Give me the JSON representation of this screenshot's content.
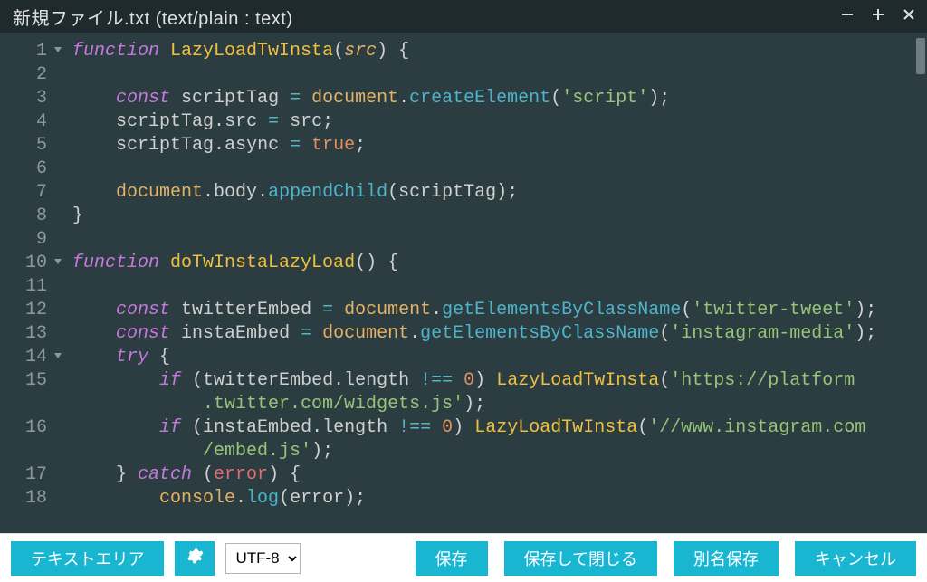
{
  "title": "新規ファイル.txt (text/plain : text)",
  "gutter": {
    "lines": [
      "1",
      "2",
      "3",
      "4",
      "5",
      "6",
      "7",
      "8",
      "9",
      "10",
      "11",
      "12",
      "13",
      "14",
      "15",
      "",
      "16",
      "",
      "17",
      "18"
    ],
    "fold_at": [
      0,
      9,
      13
    ]
  },
  "code": [
    [
      [
        "kw",
        "function"
      ],
      [
        "punc",
        " "
      ],
      [
        "fn",
        "LazyLoadTwInsta"
      ],
      [
        "punc",
        "("
      ],
      [
        "param",
        "src"
      ],
      [
        "punc",
        ") {"
      ]
    ],
    [],
    [
      [
        "punc",
        "    "
      ],
      [
        "kw",
        "const"
      ],
      [
        "punc",
        " "
      ],
      [
        "var",
        "scriptTag"
      ],
      [
        "punc",
        " "
      ],
      [
        "op",
        "="
      ],
      [
        "punc",
        " "
      ],
      [
        "obj",
        "document"
      ],
      [
        "punc",
        "."
      ],
      [
        "method",
        "createElement"
      ],
      [
        "punc",
        "("
      ],
      [
        "str",
        "'script'"
      ],
      [
        "punc",
        ");"
      ]
    ],
    [
      [
        "punc",
        "    "
      ],
      [
        "var",
        "scriptTag"
      ],
      [
        "punc",
        "."
      ],
      [
        "prop",
        "src"
      ],
      [
        "punc",
        " "
      ],
      [
        "op",
        "="
      ],
      [
        "punc",
        " "
      ],
      [
        "var",
        "src"
      ],
      [
        "punc",
        ";"
      ]
    ],
    [
      [
        "punc",
        "    "
      ],
      [
        "var",
        "scriptTag"
      ],
      [
        "punc",
        "."
      ],
      [
        "prop",
        "async"
      ],
      [
        "punc",
        " "
      ],
      [
        "op",
        "="
      ],
      [
        "punc",
        " "
      ],
      [
        "bool",
        "true"
      ],
      [
        "punc",
        ";"
      ]
    ],
    [],
    [
      [
        "punc",
        "    "
      ],
      [
        "obj",
        "document"
      ],
      [
        "punc",
        "."
      ],
      [
        "prop",
        "body"
      ],
      [
        "punc",
        "."
      ],
      [
        "method",
        "appendChild"
      ],
      [
        "punc",
        "("
      ],
      [
        "var",
        "scriptTag"
      ],
      [
        "punc",
        ");"
      ]
    ],
    [
      [
        "punc",
        "}"
      ]
    ],
    [],
    [
      [
        "kw",
        "function"
      ],
      [
        "punc",
        " "
      ],
      [
        "fn",
        "doTwInstaLazyLoad"
      ],
      [
        "punc",
        "() {"
      ]
    ],
    [],
    [
      [
        "punc",
        "    "
      ],
      [
        "kw",
        "const"
      ],
      [
        "punc",
        " "
      ],
      [
        "var",
        "twitterEmbed"
      ],
      [
        "punc",
        " "
      ],
      [
        "op",
        "="
      ],
      [
        "punc",
        " "
      ],
      [
        "obj",
        "document"
      ],
      [
        "punc",
        "."
      ],
      [
        "method",
        "getElementsByClassName"
      ],
      [
        "punc",
        "("
      ],
      [
        "str",
        "'twitter-tweet'"
      ],
      [
        "punc",
        ");"
      ]
    ],
    [
      [
        "punc",
        "    "
      ],
      [
        "kw",
        "const"
      ],
      [
        "punc",
        " "
      ],
      [
        "var",
        "instaEmbed"
      ],
      [
        "punc",
        " "
      ],
      [
        "op",
        "="
      ],
      [
        "punc",
        " "
      ],
      [
        "obj",
        "document"
      ],
      [
        "punc",
        "."
      ],
      [
        "method",
        "getElementsByClassName"
      ],
      [
        "punc",
        "("
      ],
      [
        "str",
        "'instagram-media'"
      ],
      [
        "punc",
        ");"
      ]
    ],
    [
      [
        "punc",
        "    "
      ],
      [
        "kw",
        "try"
      ],
      [
        "punc",
        " {"
      ]
    ],
    [
      [
        "punc",
        "        "
      ],
      [
        "kw",
        "if"
      ],
      [
        "punc",
        " ("
      ],
      [
        "var",
        "twitterEmbed"
      ],
      [
        "punc",
        "."
      ],
      [
        "prop",
        "length"
      ],
      [
        "punc",
        " "
      ],
      [
        "op",
        "!=="
      ],
      [
        "punc",
        " "
      ],
      [
        "num",
        "0"
      ],
      [
        "punc",
        ") "
      ],
      [
        "fn",
        "LazyLoadTwInsta"
      ],
      [
        "punc",
        "("
      ],
      [
        "str",
        "'https://platform"
      ]
    ],
    [
      [
        "punc",
        "            "
      ],
      [
        "str",
        ".twitter.com/widgets.js'"
      ],
      [
        "punc",
        ");"
      ]
    ],
    [
      [
        "punc",
        "        "
      ],
      [
        "kw",
        "if"
      ],
      [
        "punc",
        " ("
      ],
      [
        "var",
        "instaEmbed"
      ],
      [
        "punc",
        "."
      ],
      [
        "prop",
        "length"
      ],
      [
        "punc",
        " "
      ],
      [
        "op",
        "!=="
      ],
      [
        "punc",
        " "
      ],
      [
        "num",
        "0"
      ],
      [
        "punc",
        ") "
      ],
      [
        "fn",
        "LazyLoadTwInsta"
      ],
      [
        "punc",
        "("
      ],
      [
        "str",
        "'//www.instagram.com"
      ]
    ],
    [
      [
        "punc",
        "            "
      ],
      [
        "str",
        "/embed.js'"
      ],
      [
        "punc",
        ");"
      ]
    ],
    [
      [
        "punc",
        "    } "
      ],
      [
        "kw",
        "catch"
      ],
      [
        "punc",
        " ("
      ],
      [
        "err",
        "error"
      ],
      [
        "punc",
        ") {"
      ]
    ],
    [
      [
        "punc",
        "        "
      ],
      [
        "obj",
        "console"
      ],
      [
        "punc",
        "."
      ],
      [
        "method",
        "log"
      ],
      [
        "punc",
        "("
      ],
      [
        "var",
        "error"
      ],
      [
        "punc",
        ");"
      ]
    ]
  ],
  "toolbar": {
    "text_area": "テキストエリア",
    "encoding_selected": "UTF-8",
    "encoding_options": [
      "UTF-8"
    ],
    "save": "保存",
    "save_close": "保存して閉じる",
    "save_as": "別名保存",
    "cancel": "キャンセル"
  }
}
